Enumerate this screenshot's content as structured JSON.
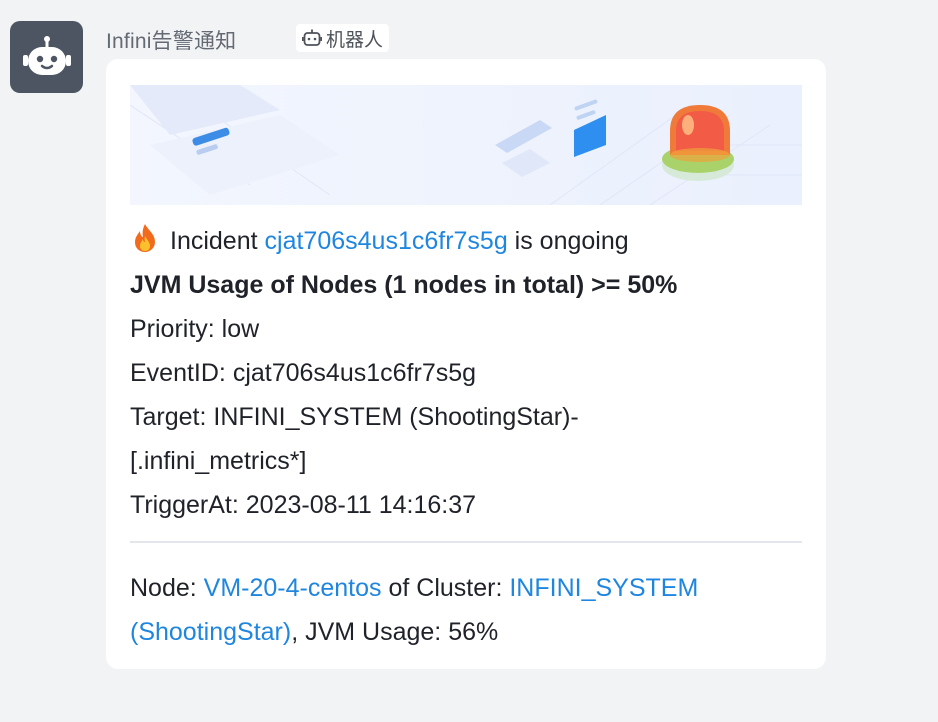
{
  "sender": {
    "name": "Infini告警通知",
    "tag_label": "机器人",
    "avatar_icon": "robot-icon",
    "tag_icon": "robot-small-icon"
  },
  "card": {
    "banner_icon": "alert-siren-illustration",
    "incident_line": {
      "emoji_icon": "fire-emoji-icon",
      "prefix": "Incident ",
      "id_link": "cjat706s4us1c6fr7s5g",
      "suffix": " is ongoing"
    },
    "title": "JVM Usage of Nodes (1 nodes in total) >= 50%",
    "priority": "Priority: low",
    "event_id": "EventID: cjat706s4us1c6fr7s5g",
    "target_line1": "Target: INFINI_SYSTEM (ShootingStar)-",
    "target_line2": "[.infini_metrics*]",
    "trigger_at": "TriggerAt: 2023-08-11 14:16:37",
    "node": {
      "prefix": "Node: ",
      "node_link": "VM-20-4-centos",
      "middle": " of Cluster: ",
      "cluster_link_line1": "INFINI_SYSTEM",
      "cluster_link_line2": "(ShootingStar)",
      "suffix": ", JVM Usage: 56%"
    }
  },
  "colors": {
    "link": "#1f86e0",
    "background": "#f2f3f5",
    "avatar": "#4d5563"
  }
}
